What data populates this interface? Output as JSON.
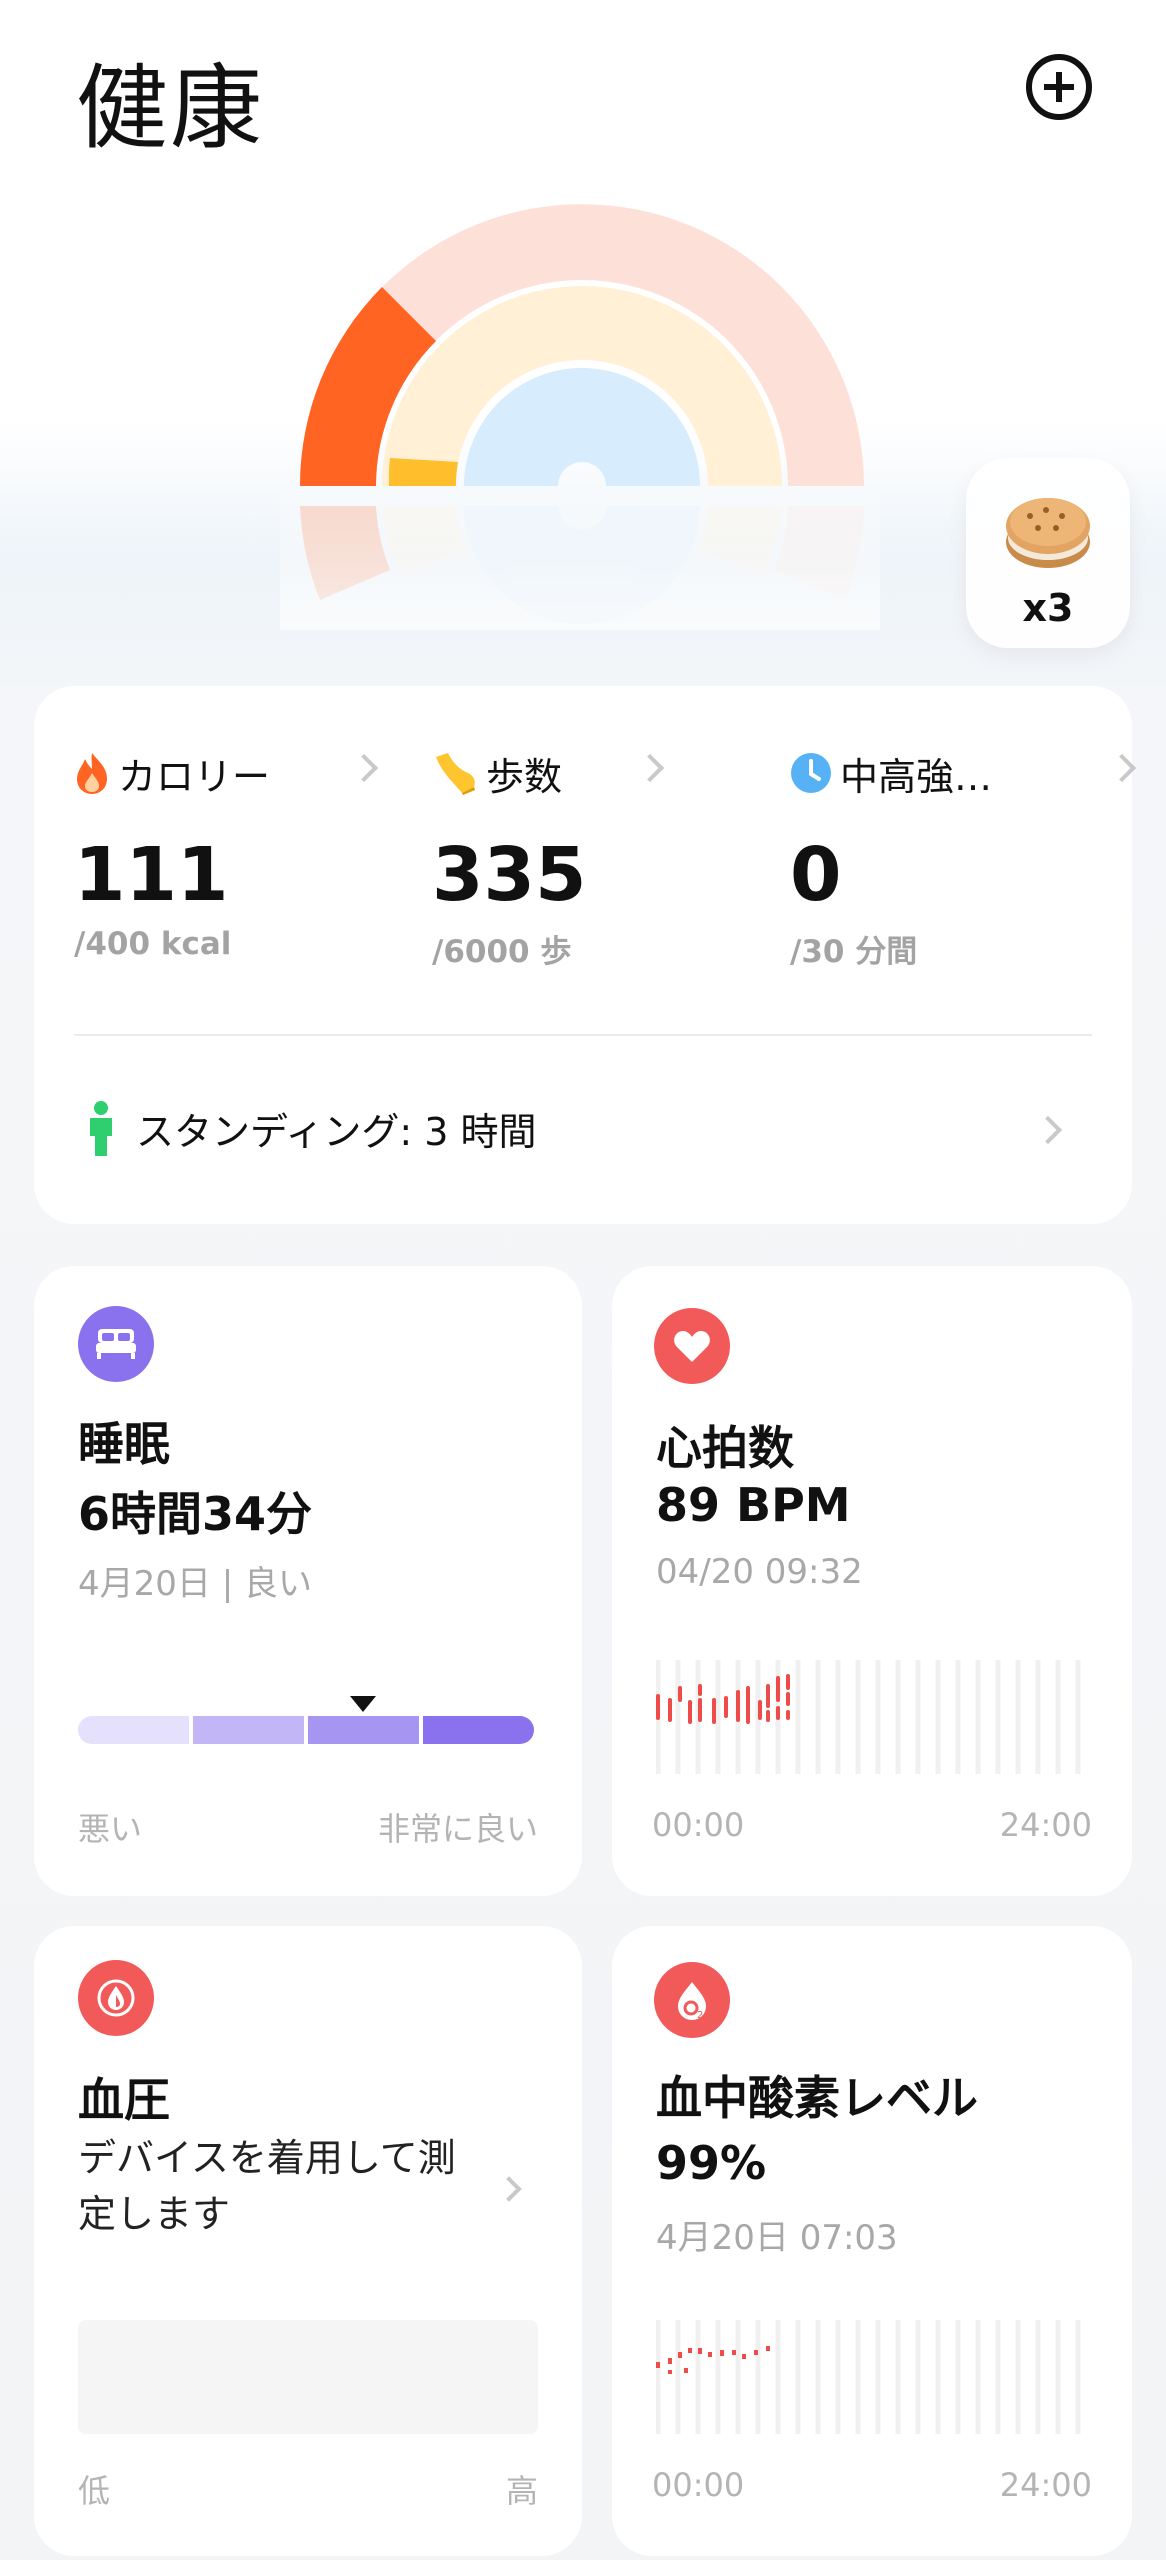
{
  "header": {
    "title": "健康"
  },
  "activity": {
    "reward_count": "x3"
  },
  "summary": {
    "calories": {
      "label": "カロリー",
      "value": "111",
      "goal": "/400 kcal"
    },
    "steps": {
      "label": "歩数",
      "value": "335",
      "goal": "/6000 歩"
    },
    "intensity": {
      "label": "中高強…",
      "value": "0",
      "goal": "/30 分間"
    },
    "standing": {
      "label": "スタンディング: 3 時間"
    }
  },
  "sleep": {
    "title": "睡眠",
    "value": "6時間34分",
    "subtitle": "4月20日 | 良い",
    "axis_low": "悪い",
    "axis_high": "非常に良い",
    "quality_level": 0.625
  },
  "heart_rate": {
    "title": "心拍数",
    "value": "89 BPM",
    "subtitle": "04/20 09:32",
    "axis_start": "00:00",
    "axis_end": "24:00"
  },
  "blood_pressure": {
    "title": "血圧",
    "message": "デバイスを着用して測定します",
    "axis_low": "低",
    "axis_high": "高"
  },
  "blood_oxygen": {
    "title": "血中酸素レベル",
    "value": "99%",
    "subtitle": "4月20日 07:03",
    "axis_start": "00:00",
    "axis_end": "24:00"
  },
  "colors": {
    "calorie": "#ff6422",
    "steps": "#ffc52e",
    "intensity": "#57b2f5",
    "standing": "#2fcf6f",
    "sleep": "#8a72ee",
    "heart": "#f25a5a"
  }
}
